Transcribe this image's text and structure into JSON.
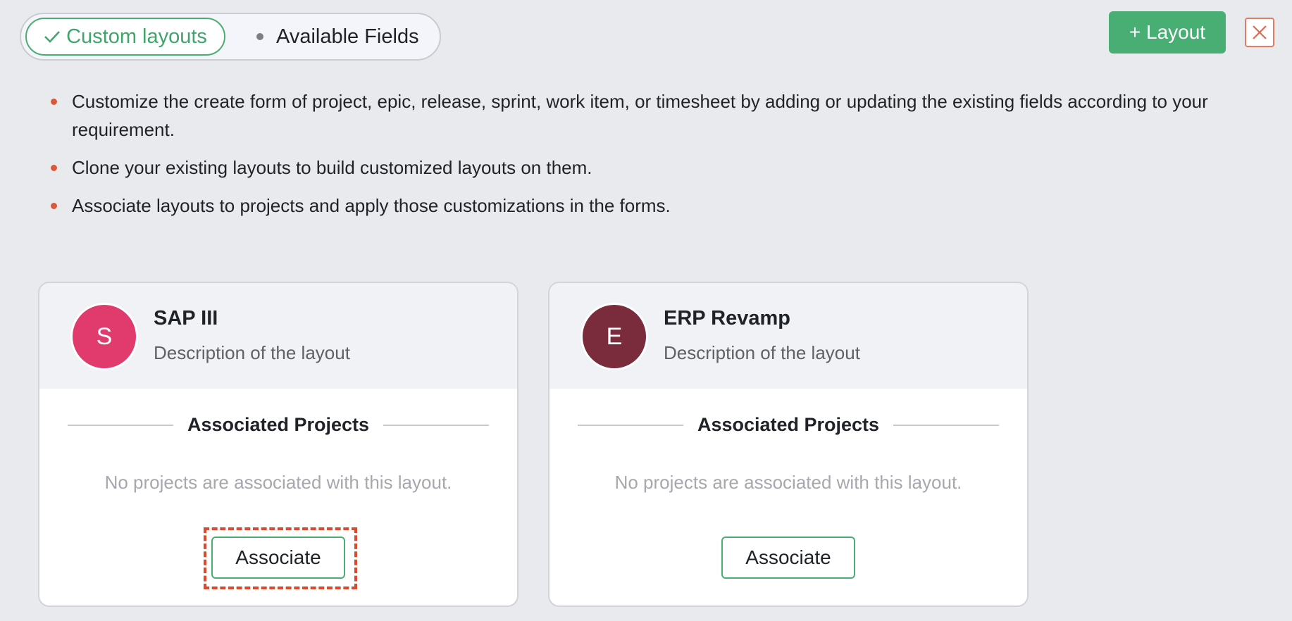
{
  "toggle": {
    "active_label": "Custom layouts",
    "inactive_label": "Available Fields"
  },
  "header": {
    "add_layout_label": "+ Layout"
  },
  "bullets": [
    "Customize the create form of project, epic, release, sprint, work item, or timesheet by adding or updating the existing fields according to your requirement.",
    "Clone your existing layouts to build customized layouts on them.",
    "Associate layouts to projects and apply those customizations in the forms."
  ],
  "layouts": [
    {
      "initial": "S",
      "title": "SAP III",
      "description": "Description of the layout",
      "avatar_color": "#e13a6c",
      "associated_heading": "Associated Projects",
      "empty_message": "No projects are associated with this layout.",
      "associate_label": "Associate"
    },
    {
      "initial": "E",
      "title": "ERP Revamp",
      "description": "Description of the layout",
      "avatar_color": "#7a2c3c",
      "associated_heading": "Associated Projects",
      "empty_message": "No projects are associated with this layout.",
      "associate_label": "Associate"
    }
  ],
  "colors": {
    "accent_green": "#49ae73",
    "bullet_red": "#d85a3c",
    "focus_red": "#dc4a2e"
  }
}
